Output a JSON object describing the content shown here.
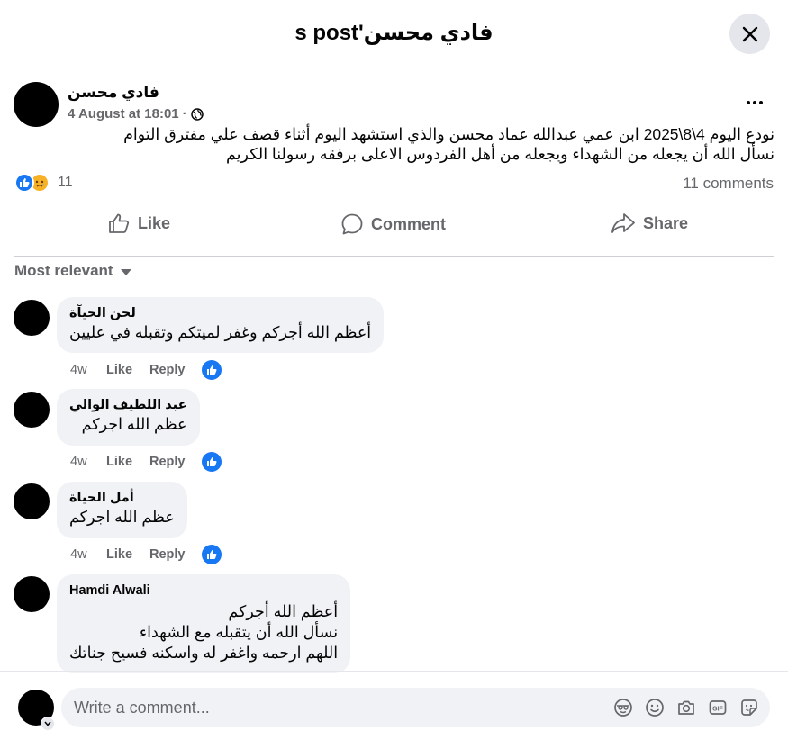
{
  "header": {
    "title": "فادي محسن's post"
  },
  "post": {
    "author": "فادي محسن",
    "date": "4 August at 18:01",
    "separator": "·",
    "privacy_icon": "globe-icon",
    "lines": [
      "نودع اليوم 4\\8\\2025 ابن عمي عبدالله عماد محسن والذي استشهد اليوم أثناء قصف علي مفترق التوام",
      "نسأل الله أن يجعله من الشهداء ويجعله من أهل الفردوس الاعلى برفقه رسولنا الكريم"
    ],
    "reaction_count": "11",
    "comments_count": "11 comments",
    "reaction_icons": [
      "like-reaction-icon",
      "sad-reaction-icon"
    ]
  },
  "actions": {
    "like": "Like",
    "comment": "Comment",
    "share": "Share"
  },
  "filter": {
    "label": "Most relevant"
  },
  "comments": [
    {
      "name": "لحن الحيآة",
      "text": "أعظم الله أجركم وغفر لميتكم وتقبله في عليين",
      "time": "4w",
      "like": "Like",
      "reply": "Reply"
    },
    {
      "name": "عبد اللطيف الوالي",
      "text": "عظم الله اجركم",
      "time": "4w",
      "like": "Like",
      "reply": "Reply"
    },
    {
      "name": "أمل الحياة",
      "text": "عظم الله اجركم",
      "time": "4w",
      "like": "Like",
      "reply": "Reply"
    },
    {
      "name": "Hamdi Alwali",
      "text": "أعظم الله أجركم\nنسأل الله أن يتقبله مع الشهداء\nاللهم ارحمه واغفر له واسكنه فسيح جناتك"
    }
  ],
  "composer": {
    "placeholder": "Write a comment..."
  },
  "colors": {
    "accent": "#1877f2",
    "secondary_text": "#65676b",
    "bubble": "#f0f2f5",
    "sad": "#f7b125"
  }
}
